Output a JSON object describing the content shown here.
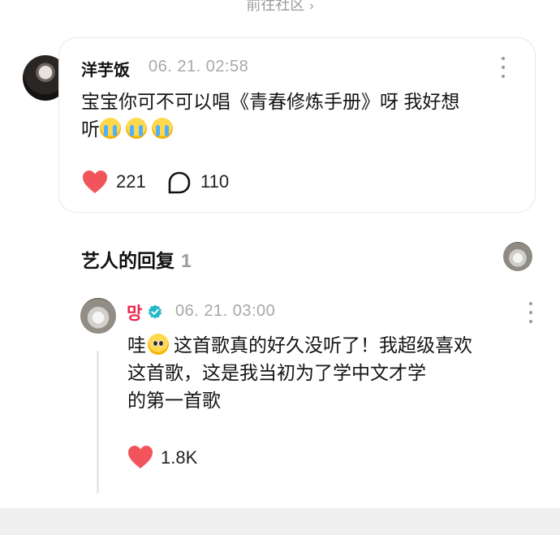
{
  "header": {
    "community_link": "前往社区",
    "chevron_icon": "chevron-right-icon"
  },
  "post": {
    "username": "洋芋饭",
    "timestamp": "06. 21. 02:58",
    "text_line1": "宝宝你可不可以唱《青春修炼手册》呀 我好想",
    "text_line2": "听",
    "emojis": [
      "crying-face-emoji",
      "crying-face-emoji",
      "crying-face-emoji"
    ],
    "likes": "221",
    "comments": "110",
    "accent_color": "#f2545b"
  },
  "artist_reply": {
    "section_title": "艺人的回复",
    "section_count": "1",
    "artist_name": "망",
    "timestamp": "06. 21. 03:00",
    "text_line1_prefix": "哇",
    "text_line1_suffix": "这首歌真的好久没听了！我超级喜欢",
    "text_line2": "这首歌，这是我当初为了学中文才学",
    "text_line3": "的第一首歌",
    "likes": "1.8K",
    "name_color": "#e8244a",
    "verified_color": "#22b8c8"
  }
}
